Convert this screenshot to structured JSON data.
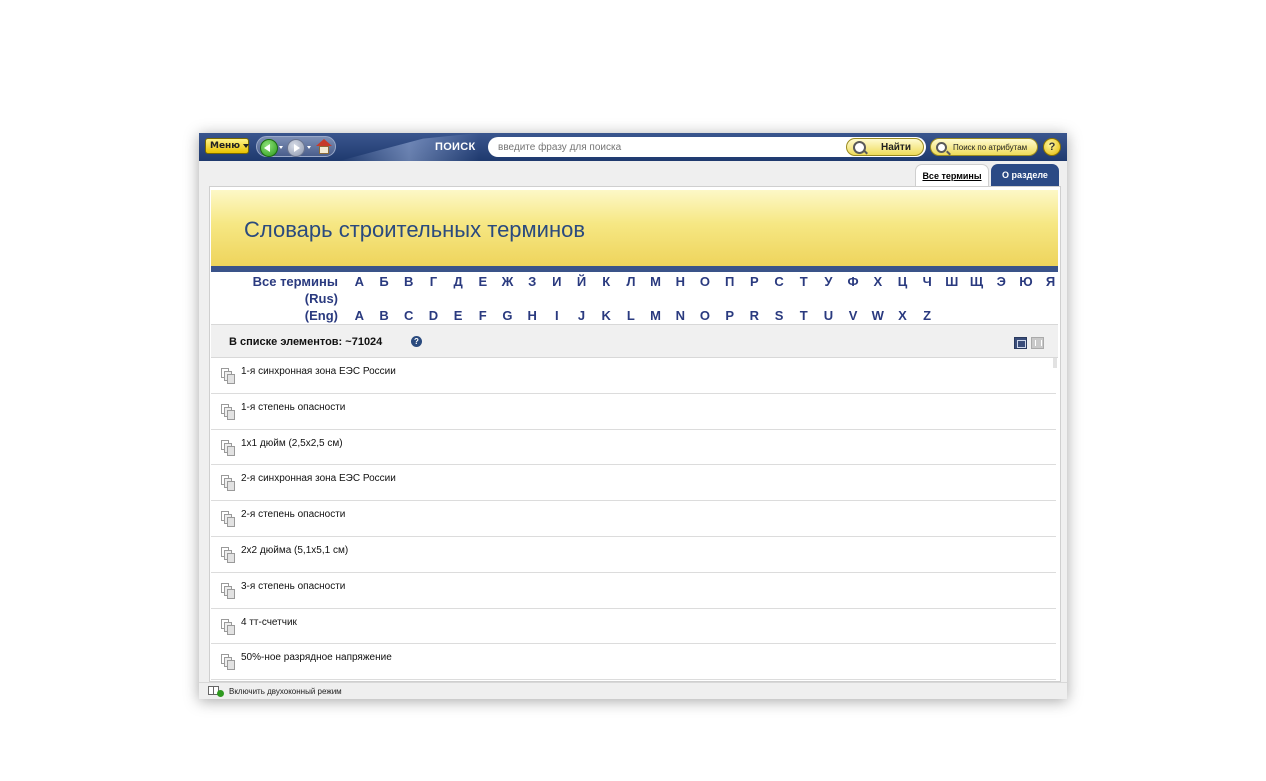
{
  "toolbar": {
    "menu_label": "Меню",
    "search_label": "ПОИСК",
    "search_placeholder": "введите фразу для поиска",
    "find_label": "Найти",
    "attr_search_label": "Поиск по атрибутам",
    "help_label": "?"
  },
  "tabs": [
    {
      "label": "Все термины",
      "active": true
    },
    {
      "label": "О разделе",
      "active": false
    }
  ],
  "banner": {
    "title": "Словарь строительных терминов"
  },
  "alphabet": {
    "all_terms_label": "Все термины",
    "rus_label": "(Rus)",
    "eng_label": "(Eng)",
    "rus_letters": [
      "А",
      "Б",
      "В",
      "Г",
      "Д",
      "Е",
      "Ж",
      "З",
      "И",
      "Й",
      "К",
      "Л",
      "М",
      "Н",
      "О",
      "П",
      "Р",
      "С",
      "Т",
      "У",
      "Ф",
      "Х",
      "Ц",
      "Ч",
      "Ш",
      "Щ",
      "Э",
      "Ю",
      "Я"
    ],
    "eng_letters": [
      "A",
      "B",
      "C",
      "D",
      "E",
      "F",
      "G",
      "H",
      "I",
      "J",
      "K",
      "L",
      "M",
      "N",
      "O",
      "P",
      "R",
      "S",
      "T",
      "U",
      "V",
      "W",
      "X",
      "Z"
    ]
  },
  "list": {
    "count_label": "В списке элементов: ~71024",
    "items": [
      "1-я синхронная зона ЕЭС России",
      "1-я степень опасности",
      "1x1 дюйм (2,5x2,5 см)",
      "2-я синхронная зона ЕЭС России",
      "2-я степень опасности",
      "2x2 дюйма (5,1x5,1 см)",
      "3-я степень опасности",
      "4 тт-счетчик",
      "50%-ное разрядное напряжение"
    ]
  },
  "status": {
    "dual_mode_label": "Включить двухоконный режим"
  },
  "colors": {
    "toolbar": "#1f3a6e",
    "accent_yellow": "#eed45c",
    "link_blue": "#2a3a7f"
  }
}
